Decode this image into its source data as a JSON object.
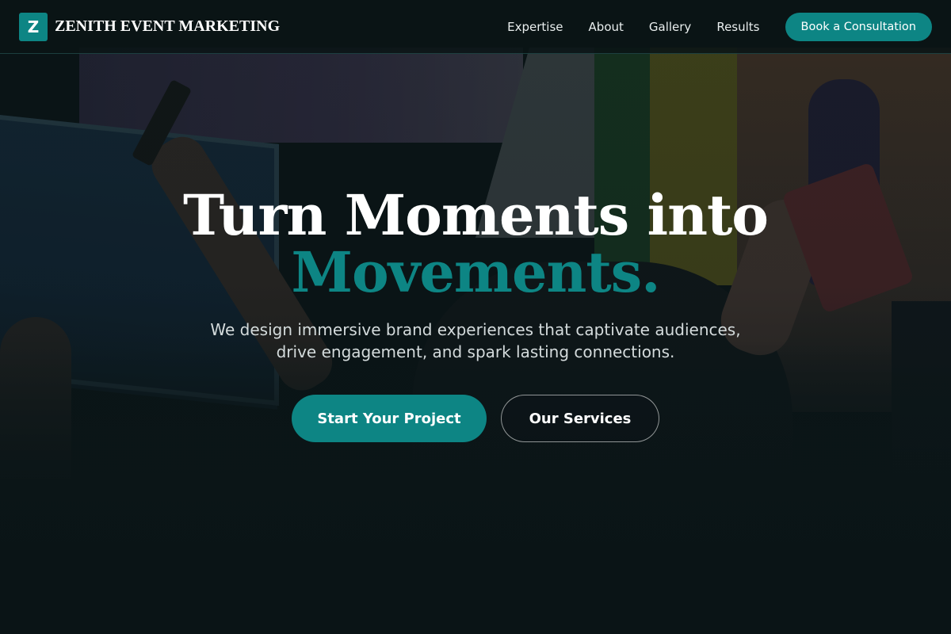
{
  "brand": {
    "logo_letter": "Z",
    "name": "ZENITH EVENT MARKETING"
  },
  "nav": {
    "links": [
      "Expertise",
      "About",
      "Gallery",
      "Results"
    ],
    "cta_label": "Book a Consultation"
  },
  "hero": {
    "headline_line1": "Turn Moments into",
    "headline_line2": "Movements.",
    "subtitle": "We design immersive brand experiences that captivate audiences, drive engagement, and spark lasting connections.",
    "primary_cta": "Start Your Project",
    "secondary_cta": "Our Services",
    "background": "event-crowd-photo"
  },
  "colors": {
    "accent": "#0d8584",
    "navbar_bg": "#0a1416",
    "headline_white": "#ffffff",
    "subtitle_text": "#d4dbdc"
  }
}
